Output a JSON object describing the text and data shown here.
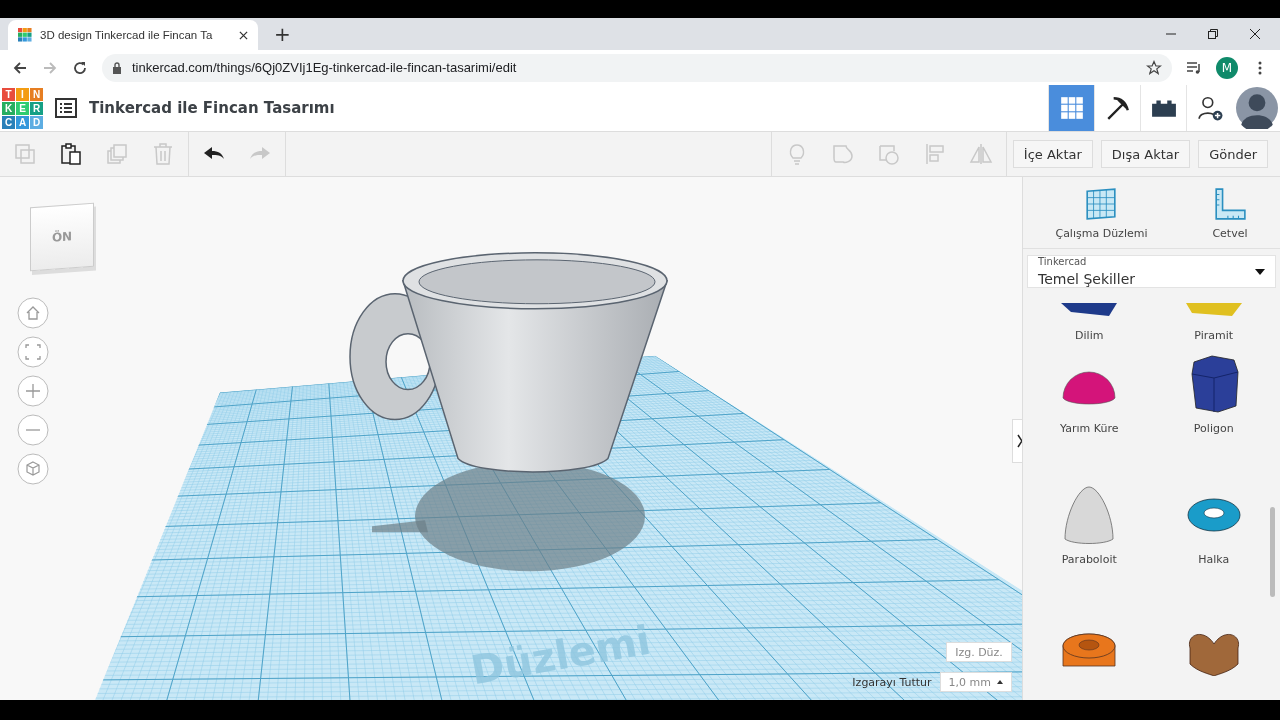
{
  "browser": {
    "tab_title": "3D design Tinkercad ile Fincan Ta",
    "new_tab": "+",
    "url": "tinkercad.com/things/6Qj0ZVIj1Eg-tinkercad-ile-fincan-tasarimi/edit",
    "profile_initial": "M"
  },
  "app": {
    "logo_letters": [
      "T",
      "I",
      "N",
      "K",
      "E",
      "R",
      "C",
      "A",
      "D"
    ],
    "design_title": "Tinkercad ile Fincan Tasarımı",
    "views": [
      {
        "kind": "grid",
        "selected": true
      },
      {
        "kind": "pickaxe",
        "selected": false
      },
      {
        "kind": "bricks",
        "selected": false
      }
    ]
  },
  "toolbar": {
    "edit_tools": [
      {
        "kind": "copy",
        "disabled": true
      },
      {
        "kind": "paste",
        "disabled": false
      },
      {
        "kind": "duplicate",
        "disabled": true
      },
      {
        "kind": "delete",
        "disabled": true
      }
    ],
    "history": [
      {
        "kind": "undo",
        "disabled": false
      },
      {
        "kind": "redo",
        "disabled": true
      }
    ],
    "shape_tools": [
      {
        "kind": "bulb",
        "disabled": true
      },
      {
        "kind": "group",
        "disabled": true
      },
      {
        "kind": "ungroup",
        "disabled": true
      },
      {
        "kind": "align",
        "disabled": true
      },
      {
        "kind": "mirror",
        "disabled": true
      }
    ],
    "buttons": [
      "İçe Aktar",
      "Dışa Aktar",
      "Gönder"
    ]
  },
  "viewport": {
    "view_cube_face": "ÖN",
    "workplane_text": "Düzlemi",
    "edit_grid_button": "Izg. Düz.",
    "snap_label": "Izgarayı Tuttur",
    "snap_value": "1,0 mm"
  },
  "panel": {
    "tools": [
      "Çalışma Düzlemi",
      "Cetvel"
    ],
    "library_label": "Tinkercad",
    "library_value": "Temel Şekiller",
    "shapes": [
      {
        "kind": "wedge",
        "label": "Dilim",
        "color": "#1e3a8a"
      },
      {
        "kind": "pyramid",
        "label": "Piramit",
        "color": "#e0c020"
      },
      {
        "kind": "hemisphere",
        "label": "Yarım Küre",
        "color": "#d4147a"
      },
      {
        "kind": "polygon",
        "label": "Poligon",
        "color": "#2b3f99"
      },
      {
        "kind": "paraboloid",
        "label": "Paraboloit",
        "color": "#d8d8d8"
      },
      {
        "kind": "torus",
        "label": "Halka",
        "color": "#1a9cc9"
      },
      {
        "kind": "tube",
        "color": "#e8761c"
      },
      {
        "kind": "heart",
        "color": "#a0683a"
      }
    ]
  }
}
